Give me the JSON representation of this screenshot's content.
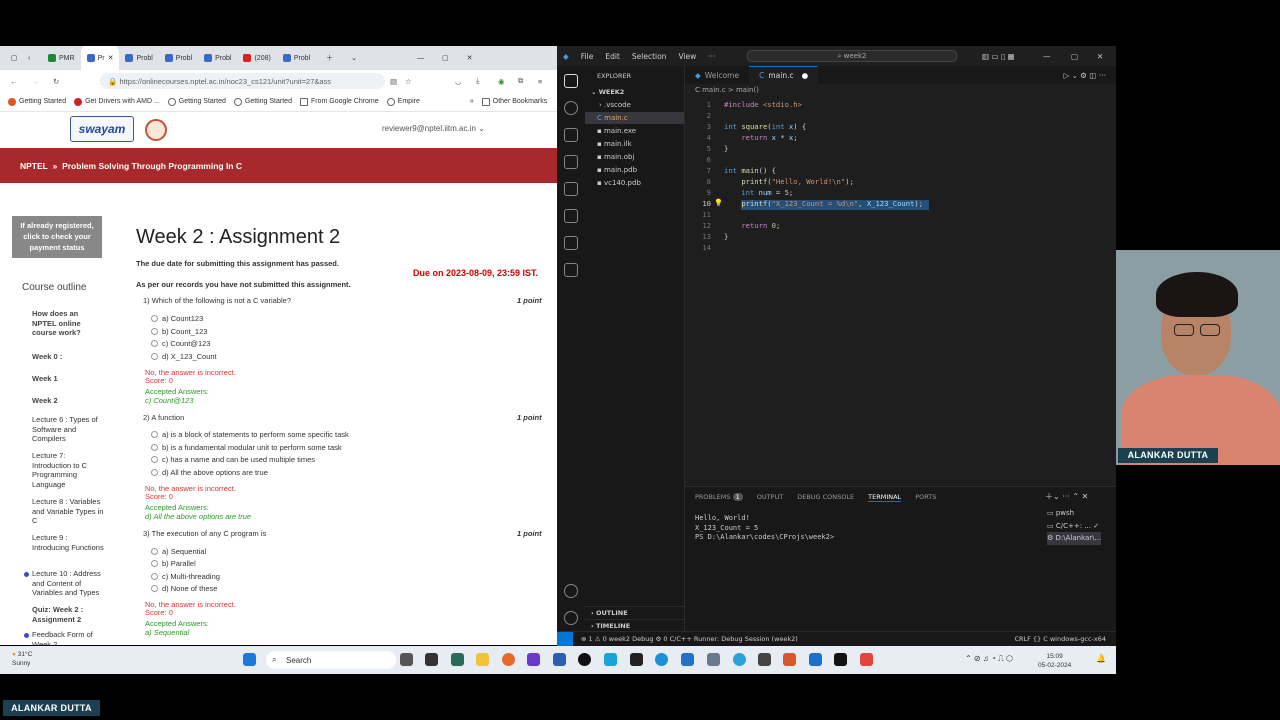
{
  "chrome": {
    "tabs": [
      "PMR",
      "Pr",
      "Probl",
      "Probl",
      "Probl",
      "(208)",
      "Probl"
    ],
    "url": "https://onlinecourses.nptel.ac.in/noc23_cs121/unit?unit=27&ass",
    "bookmarks": [
      "Getting Started",
      "Get Drivers with AMD ...",
      "Getting Started",
      "Getting Started",
      "From Google Chrome",
      "Empire",
      "Other Bookmarks"
    ]
  },
  "site": {
    "logo_text": "swayam",
    "reviewer": "reviewer9@nptel.iitm.ac.in",
    "breadcrumb_home": "NPTEL",
    "breadcrumb_sep": "»",
    "breadcrumb_course": "Problem Solving Through Programming In C",
    "register_box": "If already registered, click to check your payment status",
    "course_outline": "Course outline",
    "outline": [
      "How does an NPTEL online course work?",
      "Week 0 :",
      "Week 1",
      "Week 2",
      "Lecture 6 : Types of Software and Compilers",
      "Lecture 7: Introduction to C Programming Language",
      "Lecture 8 : Variables and Variable Types in C",
      "Lecture 9 : Introducing Functions",
      "Lecture 10 : Address and Content of Variables and Types",
      "Quiz: Week 2 : Assignment 2",
      "Feedback Form of Week 2"
    ]
  },
  "assignment": {
    "title": "Week 2 : Assignment 2",
    "due_note": "The due date for submitting this assignment has passed.",
    "due_on": "Due on 2023-08-09, 23:59 IST.",
    "records": "As per our records you have not submitted this assignment.",
    "q1": {
      "text": "1)   Which of the following is not a C variable?",
      "points": "1 point",
      "options": [
        "a) Count123",
        "b) Count_123",
        "c) Count@123",
        "d) X_123_Count"
      ],
      "status": "No, the answer is incorrect.",
      "score": "Score: 0",
      "accepted": "Accepted Answers:",
      "answer": "c) Count@123"
    },
    "q2": {
      "text": "2)   A function",
      "points": "1 point",
      "options": [
        "a) is a block of statements to perform some specific task",
        "b) is a fundamental modular unit to perform some task",
        "c) has a name and can be used multiple times",
        "d) All the above options are true"
      ],
      "status": "No, the answer is incorrect.",
      "score": "Score: 0",
      "accepted": "Accepted Answers:",
      "answer": "d) All the above options are true"
    },
    "q3": {
      "text": "3)   The execution of any C program is",
      "points": "1 point",
      "options": [
        "a) Sequential",
        "b) Parallel",
        "c) Multi-threading",
        "d) None of these"
      ],
      "status": "No, the answer is incorrect.",
      "score": "Score: 0",
      "accepted": "Accepted Answers:",
      "answer": "a) Sequential"
    }
  },
  "vscode": {
    "menus": [
      "File",
      "Edit",
      "Selection",
      "View"
    ],
    "search": "week2",
    "explorer": "EXPLORER",
    "folder": "WEEK2",
    "files": [
      ".vscode",
      "main.c",
      "main.exe",
      "main.ilk",
      "main.obj",
      "main.pdb",
      "vc140.pdb"
    ],
    "tabs": [
      "Welcome",
      "main.c"
    ],
    "breadcrumb": "C  main.c  >  main()",
    "line_numbers": [
      "1",
      "2",
      "3",
      "4",
      "5",
      "6",
      "7",
      "8",
      "9",
      "10",
      "11",
      "12",
      "13",
      "14"
    ],
    "panel_tabs": [
      "PROBLEMS",
      "1",
      "OUTPUT",
      "DEBUG CONSOLE",
      "TERMINAL",
      "PORTS"
    ],
    "terminal": [
      "Hello, World!",
      "X_123_Count = 5",
      "PS D:\\Alankar\\codes\\CProjs\\week2>"
    ],
    "terminals": [
      "pwsh",
      "C/C++: ...",
      "D:\\Alankar\\..."
    ],
    "outline_sections": [
      "OUTLINE",
      "TIMELINE"
    ],
    "status_left": "⊗ 1 ⚠ 0   week2   Debug   ⚙ 0   C/C++ Runner: Debug Session (week2)",
    "status_right": "CRLF   {}  C   windows-gcc-x64"
  },
  "taskbar": {
    "temp": "31°C",
    "weather": "Sunny",
    "search": "Search",
    "time": "15:09",
    "date": "05-02-2024"
  },
  "webcam": {
    "name": "ALANKAR DUTTA"
  },
  "footer_name": "ALANKAR DUTTA",
  "colors": {
    "nptel_red": "#a8292b",
    "vscode_bg": "#1e1e1e",
    "selection": "#264f78",
    "name_plate": "#1c3f52"
  }
}
